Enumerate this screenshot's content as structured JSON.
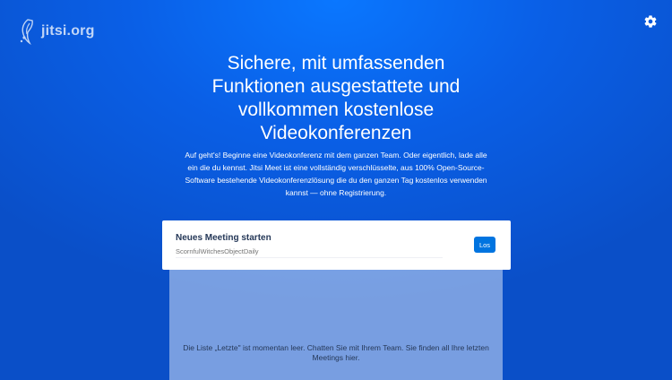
{
  "header": {
    "logo_text": "jitsi.org",
    "logo_icon": "jitsi-logo-icon",
    "settings_icon": "gear-icon"
  },
  "hero": {
    "headline": "Sichere, mit umfassenden Funktionen ausgestattete und vollkommen kostenlose Videokonferenzen",
    "description": "Auf geht's! Beginne eine Videokonferenz mit dem ganzen Team. Oder eigentlich, lade alle ein die du kennst. Jitsi Meet ist eine vollständig verschlüsselte, aus 100% Open-Source-Software bestehende Videokonferenzlösung die du den ganzen Tag kostenlos verwenden kannst — ohne Registrierung."
  },
  "meeting_card": {
    "title": "Neues Meeting starten",
    "room_placeholder": "ScornfulWitchesObjectDaily",
    "go_label": "Los"
  },
  "recent": {
    "empty_text": "Die Liste „Letzte\" ist momentan leer. Chatten Sie mit Ihrem Team. Sie finden all Ihre letzten Meetings hier."
  },
  "colors": {
    "background": "#0a5fe6",
    "button": "#0074e0",
    "card_title": "#253858"
  }
}
